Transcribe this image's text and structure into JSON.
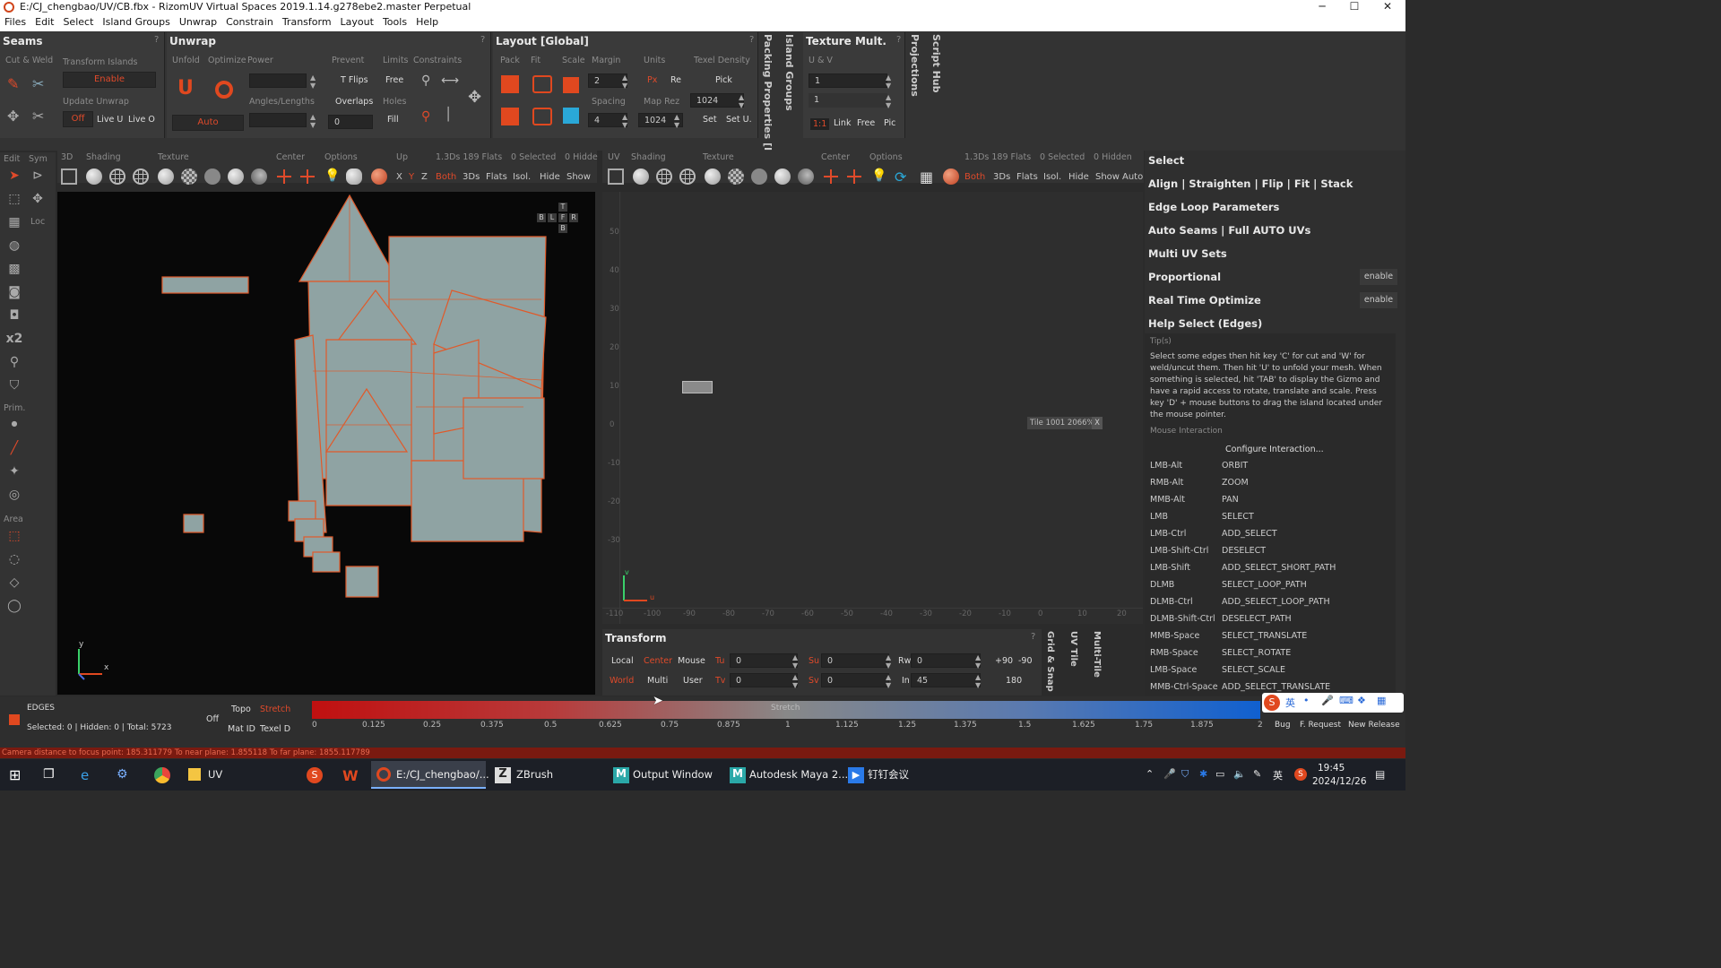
{
  "window": {
    "title": "E:/CJ_chengbao/UV/CB.fbx - RizomUV  Virtual Spaces 2019.1.14.g278ebe2.master Perpetual",
    "minimize": "─",
    "maximize": "☐",
    "close": "✕"
  },
  "menu": [
    "Files",
    "Edit",
    "Select",
    "Island Groups",
    "Unwrap",
    "Constrain",
    "Transform",
    "Layout",
    "Tools",
    "Help"
  ],
  "seams": {
    "title": "Seams",
    "cut_weld": "Cut & Weld",
    "transform_islands": "Transform Islands",
    "enable": "Enable",
    "update_unwrap": "Update Unwrap",
    "off": "Off",
    "live_u": "Live U",
    "live_o": "Live O"
  },
  "unwrap": {
    "title": "Unwrap",
    "unfold": "Unfold",
    "optimize": "Optimize",
    "power": "Power",
    "prevent": "Prevent",
    "limits": "Limits",
    "constraints": "Constraints",
    "t_flips": "T Flips",
    "free": "Free",
    "angles_lengths": "Angles/Lengths",
    "overlaps": "Overlaps",
    "holes": "Holes",
    "fill": "Fill",
    "auto": "Auto",
    "zero": "0"
  },
  "layout": {
    "title": "Layout [Global]",
    "pack": "Pack",
    "fit": "Fit",
    "scale": "Scale",
    "margin": "Margin",
    "margin_val": "2",
    "spacing": "Spacing",
    "spacing_val": "4",
    "units": "Units",
    "px": "Px",
    "re": "Re",
    "map_rez": "Map Rez",
    "texel_density": "Texel Density",
    "pick": "Pick",
    "rez1": "1024",
    "rez2": "1024",
    "set": "Set",
    "set_u": "Set U."
  },
  "side_tabs": {
    "packing": "Packing Properties [I",
    "island_groups": "Island Groups",
    "projections": "Projections",
    "script_hub": "Script Hub"
  },
  "texture_mult": {
    "title": "Texture Mult.",
    "uv": "U & V",
    "val1": "1",
    "val2": "1",
    "ratio": "1:1",
    "link": "Link",
    "free": "Free",
    "pic": "Pic"
  },
  "vp3d_toolbar": {
    "edit": "Edit",
    "sym": "Sym",
    "three_d": "3D",
    "shading": "Shading",
    "texture": "Texture",
    "center": "Center",
    "options": "Options",
    "up": "Up",
    "stats": "1.3Ds 189 Flats",
    "selected": "0 Selected",
    "hidden": "0 Hidde",
    "x": "X",
    "y": "Y",
    "z": "Z",
    "both": "Both",
    "ds": "3Ds",
    "flats": "Flats",
    "isol": "Isol.",
    "hide": "Hide",
    "show": "Show"
  },
  "uv_toolbar": {
    "uv": "UV",
    "shading": "Shading",
    "texture": "Texture",
    "center": "Center",
    "options": "Options",
    "stats": "1.3Ds 189 Flats",
    "selected": "0 Selected",
    "hidden": "0 Hidden",
    "both": "Both",
    "ds": "3Ds",
    "flats": "Flats",
    "isol": "Isol.",
    "hide": "Hide",
    "show": "Show",
    "auto": "Auto"
  },
  "left_tools": {
    "loc": "Loc",
    "x2": "x2",
    "prim": "Prim.",
    "area": "Area"
  },
  "viewcube": {
    "t": "T",
    "b": "B",
    "l": "L",
    "f": "F",
    "r": "R",
    "bottom": "B"
  },
  "axis3d": {
    "y": "y",
    "x": "x"
  },
  "uv_view": {
    "yticks": [
      "50",
      "40",
      "30",
      "20",
      "10",
      "0",
      "-10",
      "-20",
      "-30"
    ],
    "xticks": [
      "-110",
      "-100",
      "-90",
      "-80",
      "-70",
      "-60",
      "-50",
      "-40",
      "-30",
      "-20",
      "-10",
      "0",
      "10",
      "20"
    ],
    "tile_label": "Tile 1001 2066%",
    "tile_close": "X",
    "v": "v",
    "u": "u"
  },
  "right_panel": {
    "sections": [
      "Select",
      "Align | Straighten | Flip | Fit | Stack",
      "Edge Loop Parameters",
      "Auto Seams | Full AUTO UVs",
      "Multi UV Sets"
    ],
    "proportional": "Proportional",
    "real_time": "Real Time Optimize",
    "enable": "enable",
    "help": "Help Select (Edges)",
    "tips": "Tip(s)",
    "tip_text": "Select some edges then hit key 'C' for cut and 'W' for weld/uncut them. Then hit 'U' to unfold your mesh. When something is selected, hit 'TAB' to display the Gizmo and have a rapid access to rotate, translate and scale. Press key 'D' + mouse buttons to drag the island located under the mouse pointer.",
    "mouse_interaction": "Mouse Interaction",
    "configure": "Configure Interaction...",
    "bindings": [
      [
        "LMB-Alt",
        "ORBIT"
      ],
      [
        "RMB-Alt",
        "ZOOM"
      ],
      [
        "MMB-Alt",
        "PAN"
      ],
      [
        "LMB",
        "SELECT"
      ],
      [
        "LMB-Ctrl",
        "ADD_SELECT"
      ],
      [
        "LMB-Shift-Ctrl",
        "DESELECT"
      ],
      [
        "LMB-Shift",
        "ADD_SELECT_SHORT_PATH"
      ],
      [
        "DLMB",
        "SELECT_LOOP_PATH"
      ],
      [
        "DLMB-Ctrl",
        "ADD_SELECT_LOOP_PATH"
      ],
      [
        "DLMB-Shift-Ctrl",
        "DESELECT_PATH"
      ],
      [
        "MMB-Space",
        "SELECT_TRANSLATE"
      ],
      [
        "RMB-Space",
        "SELECT_ROTATE"
      ],
      [
        "LMB-Space",
        "SELECT_SCALE"
      ],
      [
        "MMB-Ctrl-Space",
        "ADD_SELECT_TRANSLATE"
      ]
    ]
  },
  "transform": {
    "title": "Transform",
    "local": "Local",
    "center": "Center",
    "mouse": "Mouse",
    "world": "World",
    "multi": "Multi",
    "user": "User",
    "tu": "Tu",
    "tv": "Tv",
    "su": "Su",
    "sv": "Sv",
    "rw": "Rw",
    "in": "In",
    "tu_val": "0",
    "tv_val": "0",
    "su_val": "0",
    "sv_val": "0",
    "rw_val": "0",
    "in_val": "45",
    "p90": "+90",
    "m90": "-90",
    "v180": "180"
  },
  "transform_side": {
    "grid": "Grid & Snap",
    "uvtile": "UV Tile",
    "multitile": "Multi-Tile"
  },
  "bottom": {
    "edges": "EDGES",
    "counts": "Selected: 0 | Hidden: 0 | Total: 5723",
    "off": "Off",
    "topo": "Topo",
    "stretch": "Stretch",
    "mat_id": "Mat ID",
    "texel_d": "Texel D",
    "bar_label": "Stretch",
    "ticks": [
      "0",
      "0.125",
      "0.25",
      "0.375",
      "0.5",
      "0.625",
      "0.75",
      "0.875",
      "1",
      "1.125",
      "1.25",
      "1.375",
      "1.5",
      "1.625",
      "1.75",
      "1.875",
      "2"
    ],
    "bug": "Bug",
    "feature": "F. Request",
    "new_release": "New Release"
  },
  "status": "Camera distance to focus point: 185.311779  To near plane: 1.855118  To far plane: 1855.117789",
  "taskbar": {
    "apps": [
      "UV",
      "E:/CJ_chengbao/...",
      "ZBrush",
      "Output Window",
      "Autodesk Maya 2...",
      "钉钉会议"
    ],
    "time": "19:45",
    "date": "2024/12/26",
    "ime": "英"
  },
  "colors": {
    "accent": "#e0481f",
    "panel": "#3a3a3a",
    "viewport": "#080808",
    "uv_bg": "#2e2e2e",
    "mesh": "#8fa3a3",
    "mesh_edge": "#e05a2a"
  }
}
